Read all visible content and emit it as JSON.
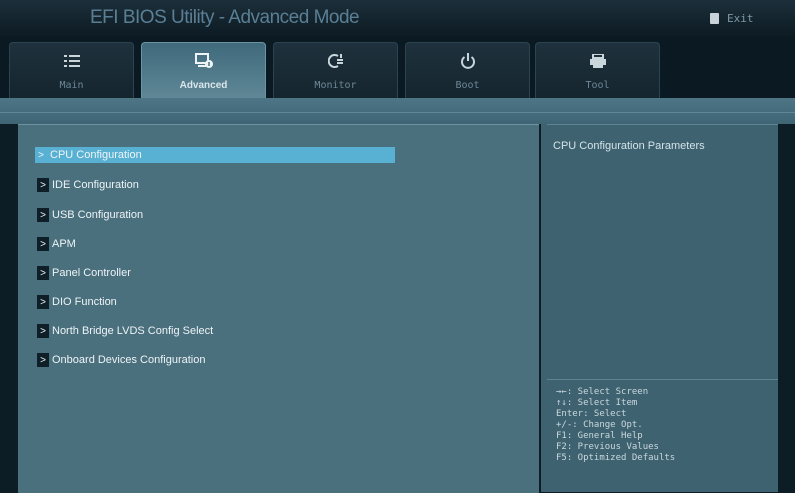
{
  "window": {
    "title": "EFI BIOS Utility - Advanced Mode",
    "exit_label": "Exit"
  },
  "tabs": [
    {
      "label": "Main",
      "icon": "list-icon",
      "active": false
    },
    {
      "label": "Advanced",
      "icon": "advanced-chip-icon",
      "active": true
    },
    {
      "label": "Monitor",
      "icon": "monitor-fan-icon",
      "active": false
    },
    {
      "label": "Boot",
      "icon": "power-icon",
      "active": false
    },
    {
      "label": "Tool",
      "icon": "printer-icon",
      "active": false
    }
  ],
  "menu": {
    "items": [
      {
        "label": "CPU Configuration",
        "selected": true
      },
      {
        "label": "IDE Configuration",
        "selected": false
      },
      {
        "label": "USB Configuration",
        "selected": false
      },
      {
        "label": "APM",
        "selected": false
      },
      {
        "label": "Panel Controller",
        "selected": false
      },
      {
        "label": "DIO Function",
        "selected": false
      },
      {
        "label": "North Bridge LVDS Config Select",
        "selected": false
      },
      {
        "label": "Onboard Devices Configuration",
        "selected": false
      }
    ],
    "arrow": ">"
  },
  "help": {
    "description": "CPU Configuration Parameters",
    "keys": [
      "→←: Select Screen",
      "↑↓: Select Item",
      "Enter: Select",
      "+/-: Change Opt.",
      "F1: General Help",
      "F2: Previous Values",
      "F5: Optimized Defaults"
    ]
  },
  "colors": {
    "selected_highlight": "#58b1d3",
    "panel_bg": "#4a6f7d",
    "active_tab": "#4f7a8b"
  }
}
